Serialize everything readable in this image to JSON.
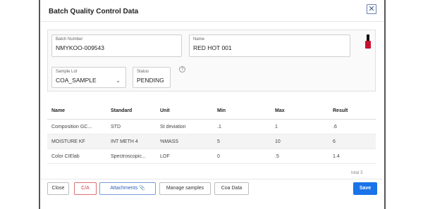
{
  "dialog": {
    "title": "Batch Quality Control Data",
    "close_symbol": "✕"
  },
  "form": {
    "batch_number": {
      "label": "Batch Number",
      "value": "NMYKOO-009543"
    },
    "name": {
      "label": "Name",
      "value": "RED HOT 001"
    },
    "sample_lot": {
      "label": "Sample Lot",
      "value": "COA_SAMPLE"
    },
    "status": {
      "label": "Status",
      "value": "PENDING",
      "help": "?"
    },
    "product_icon": "nail-polish-bottle-icon"
  },
  "table": {
    "columns": [
      "Name",
      "Standard",
      "Unit",
      "Min",
      "Max",
      "Result"
    ],
    "rows": [
      [
        "Composition GC...",
        "STD",
        "St deviation",
        ".1",
        "1",
        ".6"
      ],
      [
        "MOISTURE KF",
        "INT METH 4",
        "%MASS",
        "5",
        "10",
        "6"
      ],
      [
        "Color CIElab",
        "Spectroscopic...",
        "LOF",
        "0",
        ".5",
        "1.4"
      ]
    ],
    "total_label": "total 3"
  },
  "footer": {
    "close": "Close",
    "coa": "C/A",
    "attachments": "Attachments",
    "attachments_icon": "paperclip-icon",
    "manage_samples": "Manage samples",
    "coa_data": "Coa Data",
    "save": "Save"
  },
  "colors": {
    "primary": "#1a73e8",
    "danger": "#d04040",
    "bottle_red": "#c8102e"
  }
}
